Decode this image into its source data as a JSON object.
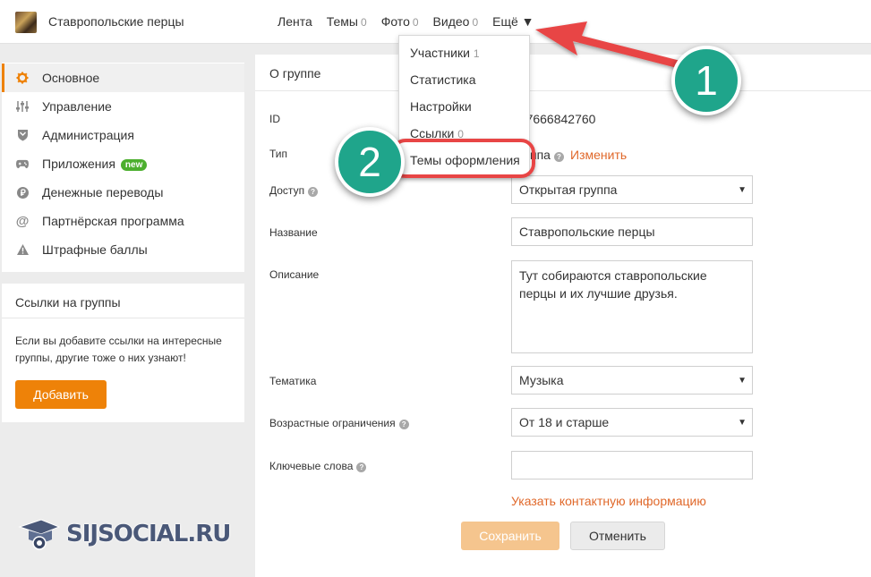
{
  "header": {
    "group_name": "Ставропольские перцы",
    "nav": [
      {
        "label": "Лента",
        "count": ""
      },
      {
        "label": "Темы",
        "count": "0"
      },
      {
        "label": "Фото",
        "count": "0"
      },
      {
        "label": "Видео",
        "count": "0"
      }
    ],
    "more_label": "Ещё ▼"
  },
  "dropdown": {
    "items": [
      {
        "label": "Участники",
        "count": "1"
      },
      {
        "label": "Статистика",
        "count": ""
      },
      {
        "label": "Настройки",
        "count": ""
      },
      {
        "label": "Ссылки",
        "count": "0"
      },
      {
        "label": "Темы оформления",
        "count": ""
      }
    ]
  },
  "sidebar": {
    "items": [
      {
        "label": "Основное",
        "icon": "gear-icon",
        "active": true
      },
      {
        "label": "Управление",
        "icon": "sliders-icon"
      },
      {
        "label": "Администрация",
        "icon": "shield-icon"
      },
      {
        "label": "Приложения",
        "icon": "gamepad-icon",
        "badge": "new"
      },
      {
        "label": "Денежные переводы",
        "icon": "ruble-icon"
      },
      {
        "label": "Партнёрская программа",
        "icon": "at-icon"
      },
      {
        "label": "Штрафные баллы",
        "icon": "warning-icon"
      }
    ],
    "links_card": {
      "title": "Ссылки на группы",
      "text": "Если вы добавите ссылки на интересные группы, другие тоже о них узнают!",
      "button": "Добавить"
    }
  },
  "main": {
    "title": "О группе",
    "id_label": "ID",
    "id_value": "377666842760",
    "type_label": "Тип",
    "type_value": "ппа",
    "type_change": "Изменить",
    "access_label": "Доступ",
    "access_value": "Открытая группа",
    "name_label": "Название",
    "name_value": "Ставропольские перцы",
    "desc_label": "Описание",
    "desc_value": "Тут собираются ставропольские перцы и их лучшие друзья.",
    "topic_label": "Тематика",
    "topic_value": "Музыка",
    "age_label": "Возрастные ограничения",
    "age_value": "От 18 и старше",
    "keywords_label": "Ключевые слова",
    "keywords_value": "",
    "contact_link": "Указать контактную информацию",
    "save_button": "Сохранить",
    "cancel_button": "Отменить"
  },
  "annotations": {
    "callout_1": "1",
    "callout_2": "2"
  },
  "watermark": "SIJSOCIAL.RU",
  "colors": {
    "accent": "#ee8208",
    "link": "#e0682a",
    "callout": "#1fa58b",
    "arrow": "#e84545"
  }
}
